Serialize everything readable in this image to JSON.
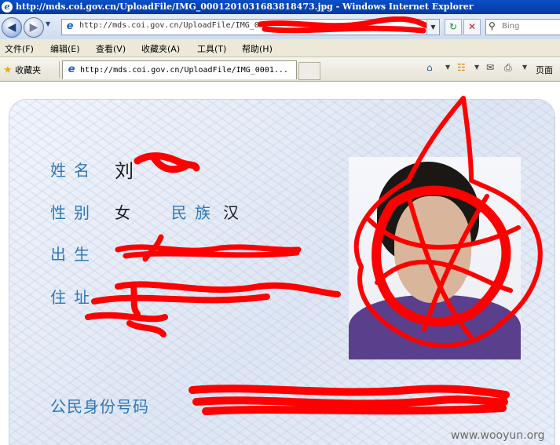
{
  "window": {
    "title": "http://mds.coi.gov.cn/UploadFile/IMG_0001201031683818473.jpg - Windows Internet Explorer"
  },
  "address_bar": {
    "url": "http://mds.coi.gov.cn/UploadFile/IMG_0",
    "refresh_icon": "refresh-icon",
    "stop_icon": "stop-icon"
  },
  "search": {
    "placeholder": "Bing"
  },
  "menu": {
    "items": [
      "文件(F)",
      "编辑(E)",
      "查看(V)",
      "收藏夹(A)",
      "工具(T)",
      "帮助(H)"
    ]
  },
  "tabs_bar": {
    "favorites_label": "收藏夹",
    "tab_title": "http://mds.coi.gov.cn/UploadFile/IMG_0001...",
    "page_label": "页面"
  },
  "id_card": {
    "name_label": "姓名",
    "name_value": "刘",
    "gender_label": "性别",
    "gender_value": "女",
    "ethnicity_label": "民族",
    "ethnicity_value": "汉",
    "birth_label": "出生",
    "address_label": "住址",
    "id_label": "公民身份号码"
  },
  "watermark": "www.wooyun.org",
  "colors": {
    "redaction": "#ff0000",
    "label_blue": "#2e78b6",
    "title_bar": "#0a50c8"
  }
}
